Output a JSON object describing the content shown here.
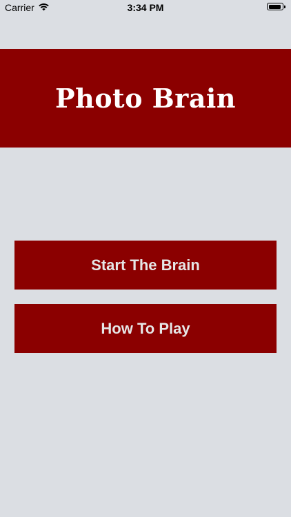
{
  "status_bar": {
    "carrier": "Carrier",
    "time": "3:34 PM",
    "battery_level": 0.9
  },
  "app": {
    "title": "Photo Brain"
  },
  "menu": {
    "start_label": "Start The Brain",
    "howto_label": "How To Play"
  },
  "colors": {
    "background": "#dbdee3",
    "accent": "#8b0000",
    "button_text": "#e6e6e6",
    "title_text": "#ffffff"
  },
  "icons": {
    "signal": "wifi-icon",
    "battery": "battery-icon"
  }
}
